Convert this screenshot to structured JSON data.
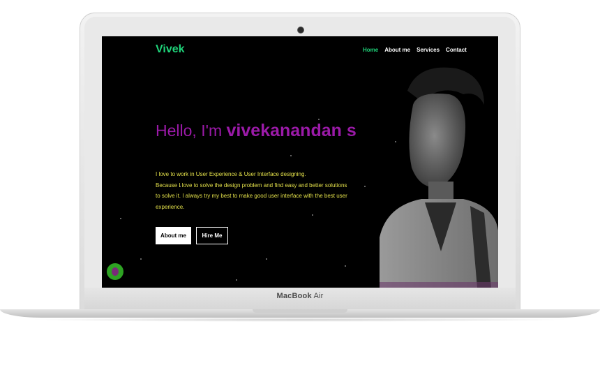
{
  "device": {
    "brand": "MacBook",
    "model": "Air"
  },
  "site": {
    "logo": "Vivek",
    "nav": [
      {
        "label": "Home",
        "active": true
      },
      {
        "label": "About me",
        "active": false
      },
      {
        "label": "Services",
        "active": false
      },
      {
        "label": "Contact",
        "active": false
      }
    ],
    "hero": {
      "greeting": "Hello, I'm",
      "name": "vivekanandan s",
      "intro_line1": "I love to work in User Experience & User Interface designing.",
      "intro_line2": "Because I love to solve the design problem and find easy and better solutions to solve it. I always try my best to make good user interface with the best user experience."
    },
    "buttons": {
      "about": "About me",
      "hire": "Hire Me"
    }
  },
  "colors": {
    "accent_green": "#1fd47a",
    "hero_purple": "#9b1aa8",
    "intro_yellow": "#e3e04a",
    "float_green": "#2ea323"
  }
}
